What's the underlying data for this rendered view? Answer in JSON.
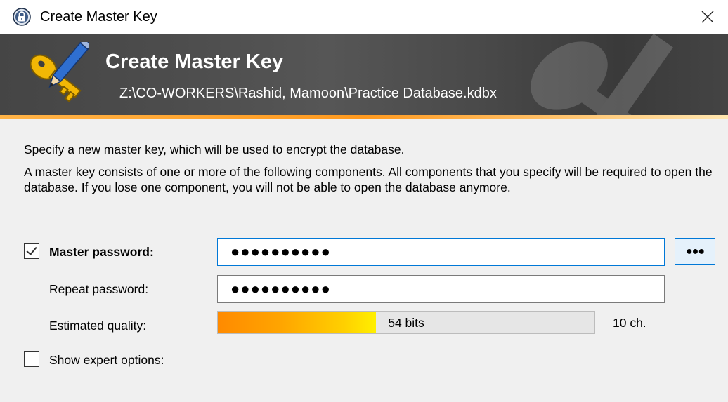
{
  "window": {
    "title": "Create Master Key",
    "close_glyph": "✕"
  },
  "banner": {
    "title": "Create Master Key",
    "path": "Z:\\CO-WORKERS\\Rashid, Mamoon\\Practice Database.kdbx"
  },
  "body": {
    "intro": "Specify a new master key, which will be used to encrypt the database.",
    "description": "A master key consists of one or more of the following components. All components that you specify will be required to open the database. If you lose one component, you will not be able to open the database anymore."
  },
  "master_password": {
    "label": "Master password:",
    "checked": true,
    "value": "●●●●●●●●●●",
    "toggle_label": "●●●"
  },
  "repeat_password": {
    "label": "Repeat password:",
    "value": "●●●●●●●●●●"
  },
  "quality": {
    "label": "Estimated quality:",
    "bits_text": "54 bits",
    "fill_fraction": 0.42,
    "char_count": "10 ch."
  },
  "expert_options": {
    "label": "Show expert options:",
    "checked": false
  },
  "colors": {
    "accent": "#0078d7",
    "banner_bg": "#4a4a4a",
    "quality_start": "#ff8a00",
    "quality_end": "#fff000"
  },
  "icons": [
    "lock-icon",
    "close-icon",
    "key-pencil-icon",
    "checkbox-checked-icon",
    "checkbox-unchecked-icon"
  ]
}
